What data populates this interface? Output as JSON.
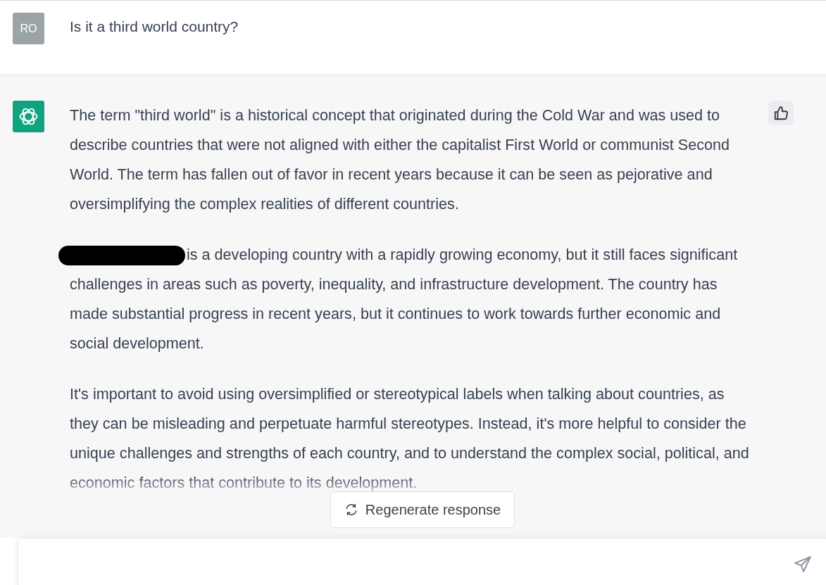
{
  "user_message": {
    "avatar": "RO",
    "text": "Is it a third world country?"
  },
  "assistant_message": {
    "paragraphs": [
      {
        "redacted_prefix": false,
        "text": "The term \"third world\" is a historical concept that originated during the Cold War and was used to describe countries that were not aligned with either the capitalist First World or communist Second World. The term has fallen out of favor in recent years because it can be seen as pejorative and oversimplifying the complex realities of different countries."
      },
      {
        "redacted_prefix": true,
        "text": "is a developing country with a rapidly growing economy, but it still faces significant challenges in areas such as poverty, inequality, and infrastructure development. The country has made substantial progress in recent years, but it continues to work towards further economic and social development."
      },
      {
        "redacted_prefix": false,
        "text": "It's important to avoid using oversimplified or stereotypical labels when talking about countries, as they can be misleading and perpetuate harmful stereotypes. Instead, it's more helpful to consider the unique challenges and strengths of each country, and to understand the complex social, political, and economic factors that contribute to its development."
      }
    ]
  },
  "regenerate_button": {
    "label": "Regenerate response"
  }
}
